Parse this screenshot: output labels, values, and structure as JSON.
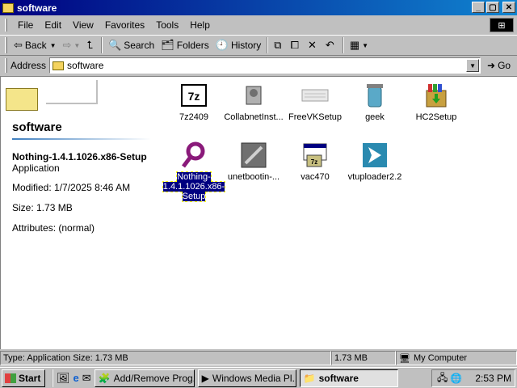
{
  "window": {
    "title": "software"
  },
  "menu": [
    "File",
    "Edit",
    "View",
    "Favorites",
    "Tools",
    "Help"
  ],
  "toolbar": {
    "back": "Back",
    "search": "Search",
    "folders": "Folders",
    "history": "History"
  },
  "address": {
    "label": "Address",
    "value": "software",
    "go": "Go"
  },
  "left_panel": {
    "title": "software",
    "selected_name": "Nothing-1.4.1.1026.x86-Setup",
    "selected_type": "Application",
    "modified": "Modified: 1/7/2025 8:46 AM",
    "size": "Size: 1.73 MB",
    "attributes": "Attributes: (normal)"
  },
  "files": [
    {
      "label": "7z2409",
      "icon": "7zip-icon"
    },
    {
      "label": "CollabnetInst...",
      "icon": "installer-icon"
    },
    {
      "label": "FreeVKSetup",
      "icon": "keyboard-icon"
    },
    {
      "label": "geek",
      "icon": "trash-can-icon"
    },
    {
      "label": "HC2Setup",
      "icon": "package-icon"
    },
    {
      "label": "Nothing-1.4.1.1026.x86-Setup",
      "icon": "magnifier-icon",
      "selected": true
    },
    {
      "label": "unetbootin-...",
      "icon": "unetbootin-icon"
    },
    {
      "label": "vac470",
      "icon": "7zip-window-icon"
    },
    {
      "label": "vtuploader2.2",
      "icon": "arrow-icon"
    }
  ],
  "status": {
    "left": "Type: Application Size: 1.73 MB",
    "size": "1.73 MB",
    "zone": "My Computer"
  },
  "taskbar": {
    "start": "Start",
    "tasks": [
      "Add/Remove Prog...",
      "Windows Media Pl...",
      "software"
    ],
    "clock": "2:53 PM"
  },
  "colors": {
    "title_bar": "#000080",
    "selection": "#000080",
    "desktop_gray": "#c0c0c0"
  }
}
